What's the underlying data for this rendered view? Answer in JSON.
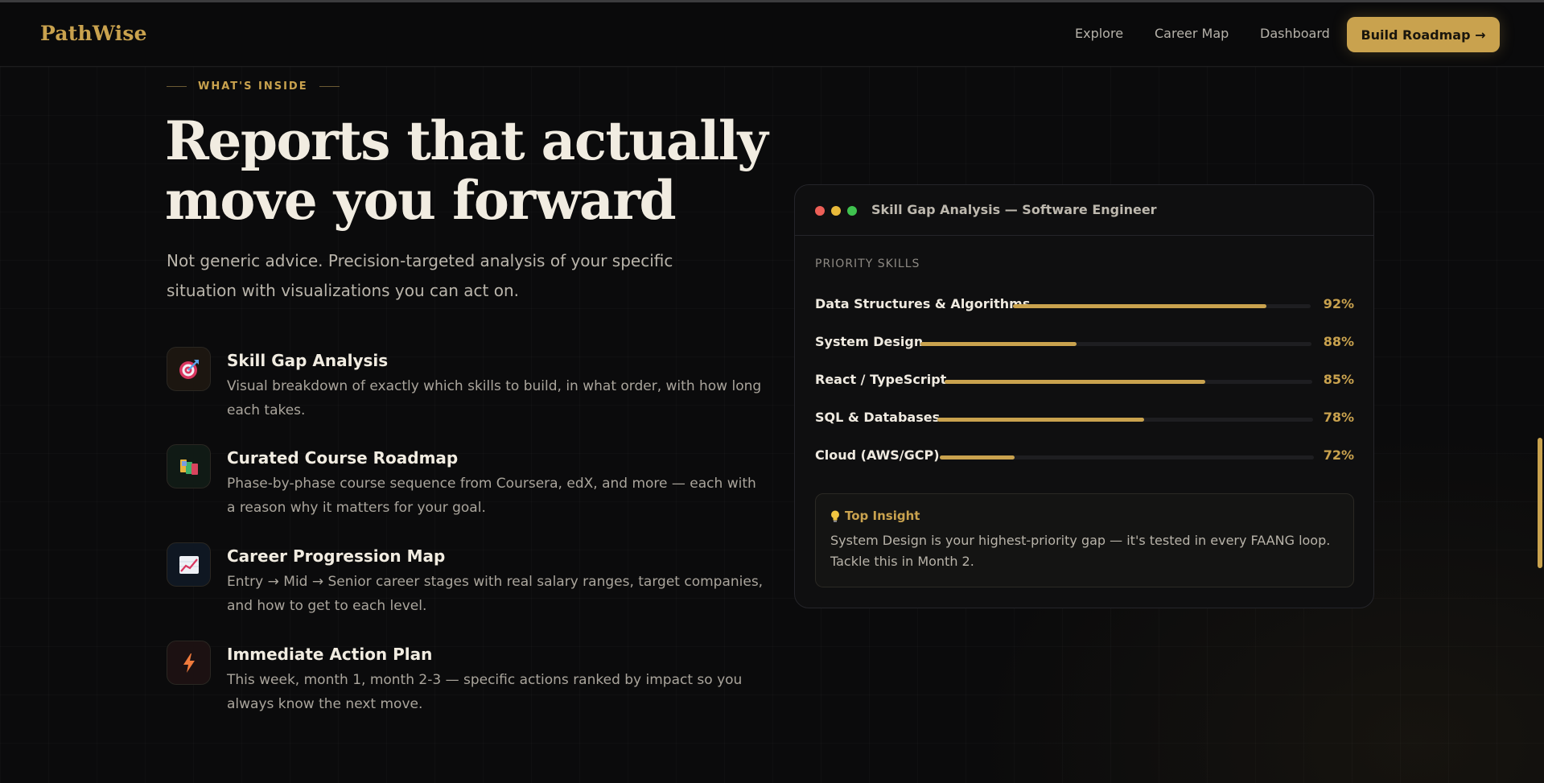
{
  "nav": {
    "logo": "PathWise",
    "links": [
      "Explore",
      "Career Map",
      "Dashboard"
    ],
    "cta": "Build Roadmap →"
  },
  "hero": {
    "eyebrow": "WHAT'S INSIDE",
    "title_line1": "Reports that actually",
    "title_line2": "move you forward",
    "subtitle": "Not generic advice. Precision-targeted analysis of your specific situation with visualizations you can act on."
  },
  "features": [
    {
      "icon": "target-icon",
      "title": "Skill Gap Analysis",
      "description": "Visual breakdown of exactly which skills to build, in what order, with how long each takes."
    },
    {
      "icon": "books-icon",
      "title": "Curated Course Roadmap",
      "description": "Phase-by-phase course sequence from Coursera, edX, and more — each with a reason why it matters for your goal."
    },
    {
      "icon": "chart-increasing-icon",
      "title": "Career Progression Map",
      "description": "Entry → Mid → Senior career stages with real salary ranges, target companies, and how to get to each level."
    },
    {
      "icon": "lightning-icon",
      "title": "Immediate Action Plan",
      "description": "This week, month 1, month 2-3 — specific actions ranked by impact so you always know the next move."
    }
  ],
  "card": {
    "title": "Skill Gap Analysis — Software Engineer",
    "section_label": "PRIORITY SKILLS",
    "skills": [
      {
        "name": "Data Structures & Algorithms",
        "percent": "92%",
        "fill": 0.85
      },
      {
        "name": "System Design",
        "percent": "88%",
        "fill": 0.4
      },
      {
        "name": "React / TypeScript",
        "percent": "85%",
        "fill": 0.71
      },
      {
        "name": "SQL & Databases",
        "percent": "78%",
        "fill": 0.55
      },
      {
        "name": "Cloud (AWS/GCP)",
        "percent": "72%",
        "fill": 0.2
      }
    ],
    "insight": {
      "icon": "lightbulb-icon",
      "title": "Top Insight",
      "body": "System Design is your highest-priority gap — it's tested in every FAANG loop. Tackle this in Month 2."
    }
  },
  "colors": {
    "accent": "#c9a24e",
    "background": "#0b0b0c",
    "dot_red": "#ed5f57",
    "dot_yellow": "#e8b93a",
    "dot_green": "#3fc24f"
  }
}
